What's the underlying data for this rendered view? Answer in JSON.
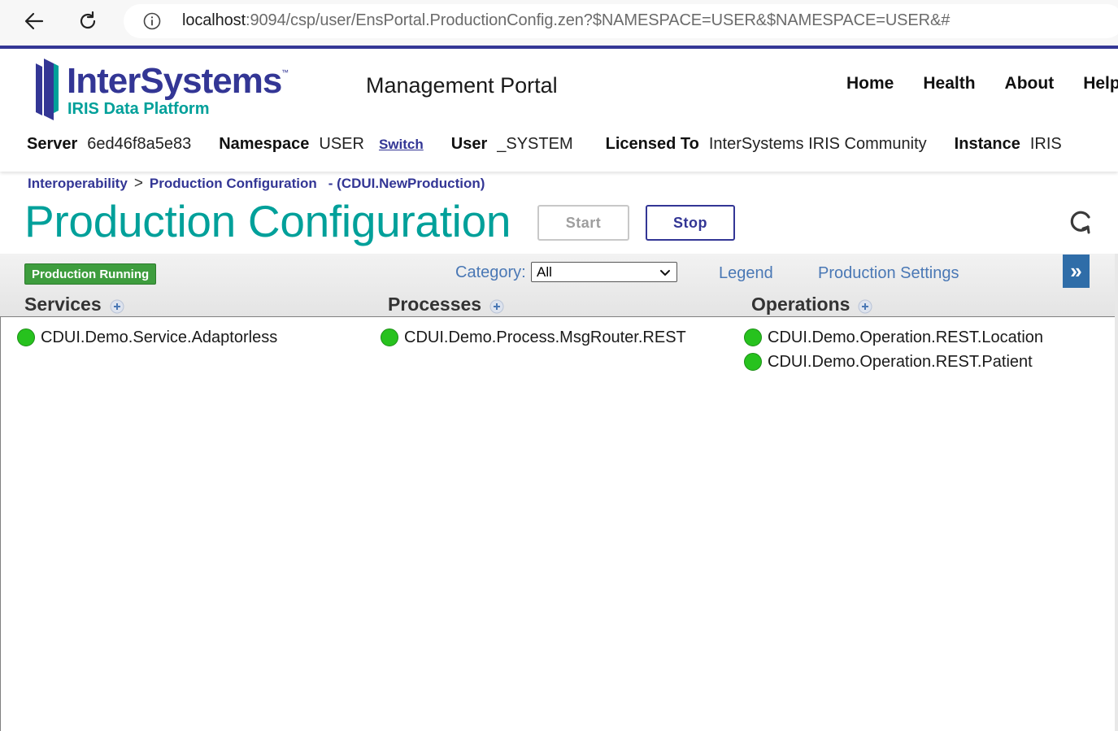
{
  "browser": {
    "url_host": "localhost",
    "url_path": ":9094/csp/user/EnsPortal.ProductionConfig.zen?$NAMESPACE=USER&$NAMESPACE=USER&#"
  },
  "header": {
    "logo_name": "InterSystems",
    "logo_tm": "™",
    "logo_sub": "IRIS Data Platform",
    "portal_title": "Management Portal",
    "menu": [
      "Home",
      "Health",
      "About",
      "Help"
    ]
  },
  "info": {
    "server_label": "Server",
    "server_value": "6ed46f8a5e83",
    "namespace_label": "Namespace",
    "namespace_value": "USER",
    "switch_label": "Switch",
    "user_label": "User",
    "user_value": "_SYSTEM",
    "licensed_label": "Licensed To",
    "licensed_value": "InterSystems IRIS Community",
    "instance_label": "Instance",
    "instance_value": "IRIS"
  },
  "breadcrumb": {
    "items": [
      "Interoperability",
      "Production Configuration"
    ],
    "separator": ">",
    "production": "- (CDUI.NewProduction)"
  },
  "page": {
    "title": "Production Configuration",
    "start_label": "Start",
    "stop_label": "Stop"
  },
  "toolbar": {
    "status": "Production Running",
    "category_label": "Category:",
    "category_value": "All",
    "legend_label": "Legend",
    "settings_label": "Production Settings",
    "expand_label": "»"
  },
  "columns": {
    "services": {
      "title": "Services",
      "items": [
        "CDUI.Demo.Service.Adaptorless"
      ]
    },
    "processes": {
      "title": "Processes",
      "items": [
        "CDUI.Demo.Process.MsgRouter.REST"
      ]
    },
    "operations": {
      "title": "Operations",
      "items": [
        "CDUI.Demo.Operation.REST.Location",
        "CDUI.Demo.Operation.REST.Patient"
      ]
    }
  },
  "colors": {
    "brand_navy": "#333695",
    "brand_teal": "#00a09a",
    "status_green": "#27c21e",
    "link_blue": "#4a78b5"
  }
}
